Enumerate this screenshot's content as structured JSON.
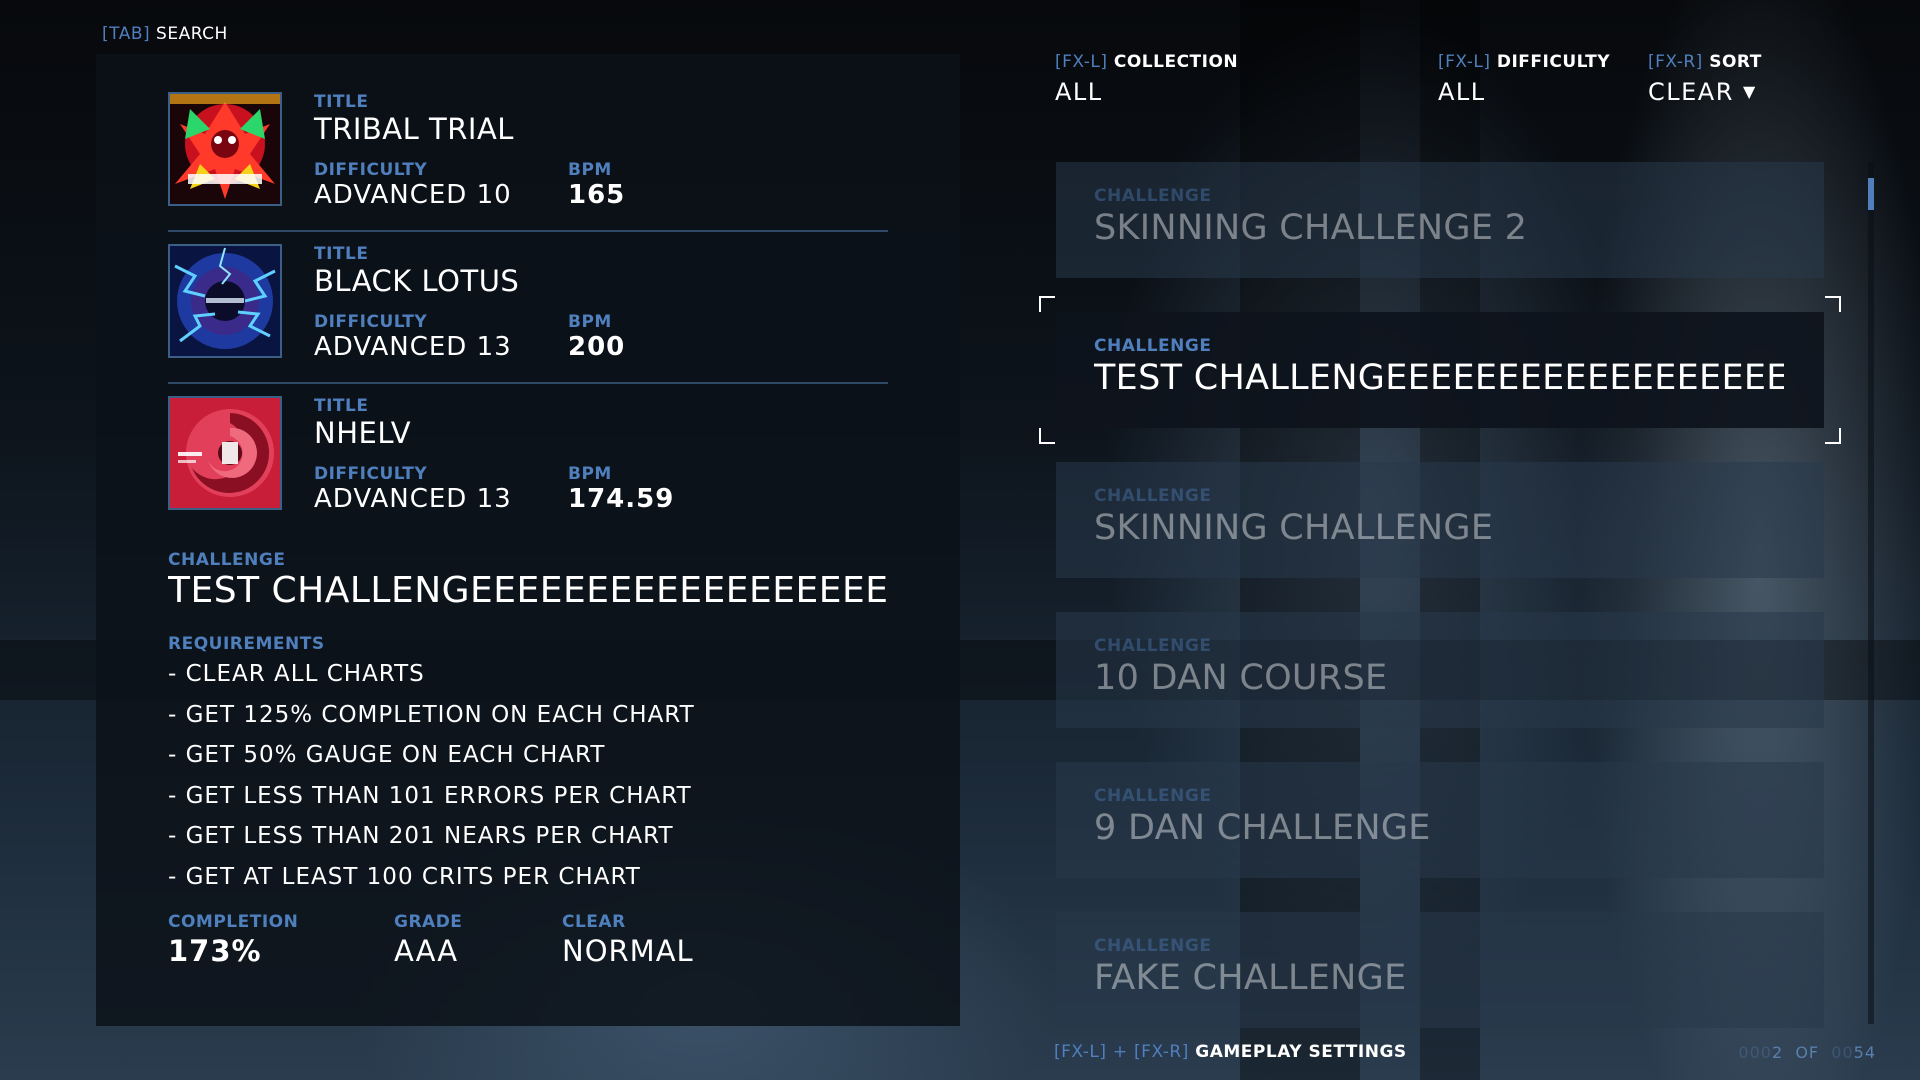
{
  "search": {
    "key": "[TAB]",
    "label": "SEARCH"
  },
  "labels": {
    "title": "TITLE",
    "difficulty": "DIFFICULTY",
    "bpm": "BPM",
    "challenge": "CHALLENGE",
    "requirements": "REQUIREMENTS",
    "completion": "COMPLETION",
    "grade": "GRADE",
    "clear": "CLEAR"
  },
  "selected": {
    "songs": [
      {
        "title": "TRIBAL TRIAL",
        "difficulty": "ADVANCED 10",
        "bpm": "165"
      },
      {
        "title": "BLACK LOTUS",
        "difficulty": "ADVANCED 13",
        "bpm": "200"
      },
      {
        "title": "NHELV",
        "difficulty": "ADVANCED 13",
        "bpm": "174.59"
      }
    ],
    "challenge": "TEST CHALLENGEEEEEEEEEEEEEEEEEEEEEEEE",
    "requirements": [
      "- CLEAR ALL CHARTS",
      "- GET 125% COMPLETION ON EACH CHART",
      "- GET 50% GAUGE ON EACH CHART",
      "- GET LESS THAN 101 ERRORS PER CHART",
      "- GET LESS THAN 201 NEARS PER CHART",
      "- GET AT LEAST 100 CRITS PER CHART"
    ],
    "completion": "173%",
    "grade": "AAA",
    "clear": "NORMAL"
  },
  "filters": {
    "collection": {
      "key": "[FX-L]",
      "label": "COLLECTION",
      "value": "ALL"
    },
    "difficulty": {
      "key": "[FX-L]",
      "label": "DIFFICULTY",
      "value": "ALL"
    },
    "sort": {
      "key": "[FX-R]",
      "label": "SORT",
      "value": "CLEAR",
      "arrow": "▼"
    }
  },
  "challenges": [
    {
      "label": "CHALLENGE",
      "name": "SKINNING CHALLENGE 2",
      "selected": false
    },
    {
      "label": "CHALLENGE",
      "name": "TEST CHALLENGEEEEEEEEEEEEEEEEEEEEEEEEE",
      "selected": true
    },
    {
      "label": "CHALLENGE",
      "name": "SKINNING CHALLENGE",
      "selected": false
    },
    {
      "label": "CHALLENGE",
      "name": "10 DAN COURSE",
      "selected": false
    },
    {
      "label": "CHALLENGE",
      "name": "9 DAN CHALLENGE",
      "selected": false
    },
    {
      "label": "CHALLENGE",
      "name": "FAKE CHALLENGE",
      "selected": false
    }
  ],
  "footer": {
    "key_left": "[FX-L]",
    "plus": "+",
    "key_right": "[FX-R]",
    "label": "GAMEPLAY SETTINGS",
    "page_current_pad": "000",
    "page_current": "2",
    "of": "OF",
    "page_total_pad": "00",
    "page_total": "54"
  },
  "colors": {
    "accent": "#4f7fbd",
    "panel": "#0c1118",
    "card": "#28384a",
    "separator": "#2f4a66"
  }
}
